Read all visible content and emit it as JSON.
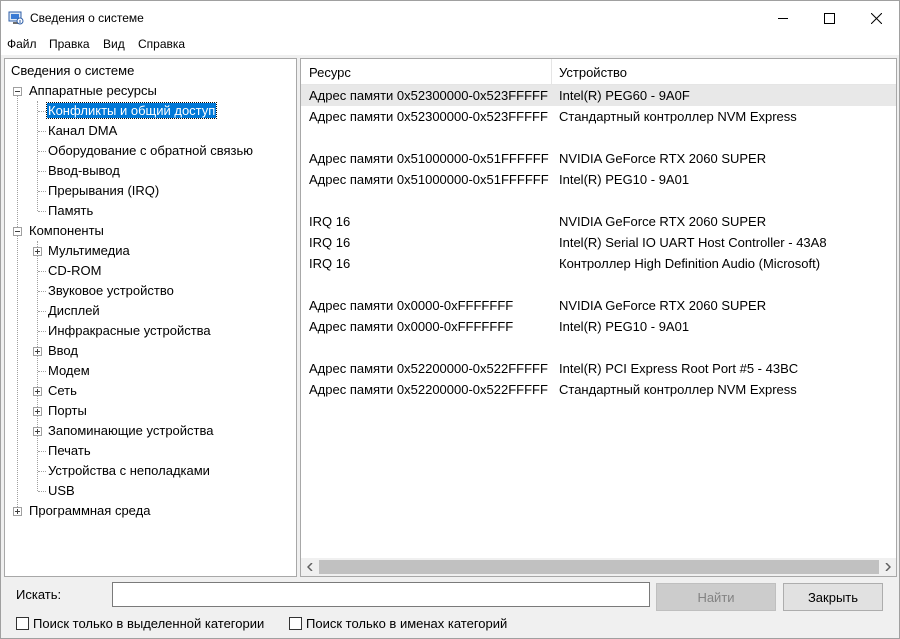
{
  "window": {
    "title": "Сведения о системе",
    "icon": "system-info-icon"
  },
  "menu": [
    "Файл",
    "Правка",
    "Вид",
    "Справка"
  ],
  "tree": {
    "root": "Сведения о системе",
    "hardware": "Аппаратные ресурсы",
    "hardware_items": [
      "Конфликты и общий доступ",
      "Канал DMA",
      "Оборудование с обратной связью",
      "Ввод-вывод",
      "Прерывания (IRQ)",
      "Память"
    ],
    "components": "Компоненты",
    "component_items": [
      "Мультимедиа",
      "CD-ROM",
      "Звуковое устройство",
      "Дисплей",
      "Инфракрасные устройства",
      "Ввод",
      "Модем",
      "Сеть",
      "Порты",
      "Запоминающие устройства",
      "Печать",
      "Устройства с неполадками",
      "USB"
    ],
    "software": "Программная среда",
    "selected": "Конфликты и общий доступ"
  },
  "list": {
    "headers": [
      "Ресурс",
      "Устройство"
    ],
    "rows": [
      [
        "Адрес памяти 0x52300000-0x523FFFFF",
        "Intel(R) PEG60 - 9A0F"
      ],
      [
        "Адрес памяти 0x52300000-0x523FFFFF",
        "Стандартный контроллер NVM Express"
      ],
      [
        "",
        ""
      ],
      [
        "Адрес памяти 0x51000000-0x51FFFFFF",
        "NVIDIA GeForce RTX 2060 SUPER"
      ],
      [
        "Адрес памяти 0x51000000-0x51FFFFFF",
        "Intel(R) PEG10 - 9A01"
      ],
      [
        "",
        ""
      ],
      [
        "IRQ 16",
        "NVIDIA GeForce RTX 2060 SUPER"
      ],
      [
        "IRQ 16",
        "Intel(R) Serial IO UART Host Controller - 43A8"
      ],
      [
        "IRQ 16",
        "Контроллер High Definition Audio (Microsoft)"
      ],
      [
        "",
        ""
      ],
      [
        "Адрес памяти 0x0000-0xFFFFFFF",
        "NVIDIA GeForce RTX 2060 SUPER"
      ],
      [
        "Адрес памяти 0x0000-0xFFFFFFF",
        "Intel(R) PEG10 - 9A01"
      ],
      [
        "",
        ""
      ],
      [
        "Адрес памяти 0x52200000-0x522FFFFF",
        "Intel(R) PCI Express Root Port #5 - 43BC"
      ],
      [
        "Адрес памяти 0x52200000-0x522FFFFF",
        "Стандартный контроллер NVM Express"
      ]
    ]
  },
  "search": {
    "label": "Искать:",
    "value": "",
    "find_button": "Найти",
    "close_button": "Закрыть",
    "only_selected_category": "Поиск только в выделенной категории",
    "only_category_names": "Поиск только в именах категорий"
  },
  "colors": {
    "selection": "#0078d7",
    "row_highlight": "#e8e8e8"
  }
}
